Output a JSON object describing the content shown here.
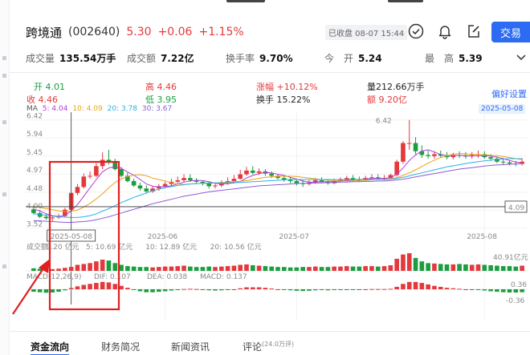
{
  "quote": {
    "name": "跨境通",
    "code": "(002640)",
    "price": "5.30",
    "change": "+0.06",
    "change_pct": "+1.15%",
    "status": "已收盘 08-07 15:44",
    "trade_label": "交易"
  },
  "stats": [
    {
      "label": "成交量",
      "value": "135.54万手"
    },
    {
      "label": "成交额",
      "value": "7.22亿"
    },
    {
      "label": "换手率",
      "value": "9.70%"
    },
    {
      "label": "今　开",
      "value": "5.24"
    },
    {
      "label": "最　高",
      "value": "5.39"
    }
  ],
  "candle_info": {
    "open": "开 4.01",
    "close": "收 4.46",
    "high": "高 4.46",
    "low": "低 3.95",
    "limit": "涨幅 +10.12%",
    "turnover": "换手 15.22%",
    "volume": "量212.66万手",
    "amount": "额 9.20亿"
  },
  "preference_label": "偏好设置",
  "ma_labels": {
    "ma": "MA",
    "ma5": "5: 4.04",
    "ma10": "10: 4.09",
    "ma20": "20: 3.78",
    "ma30": "30: 3.67"
  },
  "selected_date": "2025-05-08",
  "price_axis": [
    "6.42",
    "5.94",
    "5.45",
    "4.97",
    "4.48",
    "4.00",
    "3.52"
  ],
  "peak_label": "6.42",
  "crosshair_price": "4.09",
  "date_axis": [
    "2025-06",
    "2025-07",
    "2025-08"
  ],
  "volume_legend": {
    "title": "成交额",
    "v": "9.20 亿元",
    "v5": "5: 10.69 亿元",
    "v10": "10: 12.89 亿元",
    "v20": "20: 10.56 亿元",
    "axis_max": "40.91亿元"
  },
  "macd_legend": {
    "title": "MACD(12,26,9)",
    "dif": "DIF: 0.107",
    "dea": "DEA: 0.038",
    "macd": "MACD: 0.137",
    "axis_top": "0.36",
    "axis_bottom": "-0.36"
  },
  "tabs": [
    {
      "label": "资金流向",
      "active": true
    },
    {
      "label": "财务简况"
    },
    {
      "label": "新闻资讯"
    },
    {
      "label": "评论",
      "badge": "(24.0万评)"
    }
  ],
  "chart_data": {
    "type": "candlestick",
    "price_range": [
      3.4,
      6.5
    ],
    "open": [
      4.02,
      3.92,
      3.82,
      3.78,
      3.8,
      3.84,
      4.01,
      4.46,
      4.62,
      4.9,
      4.92,
      5.18,
      5.35,
      5.3,
      5.1,
      4.92,
      4.78,
      4.66,
      4.58,
      4.5,
      4.58,
      4.64,
      4.7,
      4.76,
      4.8,
      4.86,
      4.8,
      4.76,
      4.72,
      4.64,
      4.66,
      4.72,
      4.78,
      4.84,
      4.96,
      5.06,
      5.0,
      5.04,
      4.98,
      4.92,
      4.86,
      4.82,
      4.78,
      4.72,
      4.7,
      4.74,
      4.8,
      4.76,
      4.72,
      4.78,
      4.82,
      4.86,
      4.82,
      4.8,
      4.86,
      4.88,
      4.84,
      4.86,
      4.94,
      5.3,
      5.8,
      5.8,
      5.58,
      5.48,
      5.45,
      5.5,
      5.46,
      5.42,
      5.48,
      5.46,
      5.45,
      5.48,
      5.5,
      5.42,
      5.38,
      5.3,
      5.28,
      5.25,
      5.24
    ],
    "high": [
      4.12,
      4.0,
      3.9,
      3.84,
      3.9,
      4.06,
      4.46,
      4.7,
      4.98,
      5.04,
      5.26,
      5.55,
      5.62,
      5.38,
      5.16,
      5.0,
      4.84,
      4.74,
      4.66,
      4.64,
      4.7,
      4.76,
      4.84,
      4.9,
      4.96,
      4.96,
      4.86,
      4.8,
      4.76,
      4.74,
      4.8,
      4.88,
      4.94,
      5.08,
      5.16,
      5.18,
      5.12,
      5.1,
      5.04,
      4.96,
      4.92,
      4.88,
      4.84,
      4.8,
      4.8,
      4.86,
      4.88,
      4.82,
      4.84,
      4.88,
      4.92,
      4.94,
      4.9,
      4.92,
      4.96,
      4.96,
      4.94,
      4.98,
      5.35,
      5.85,
      6.42,
      5.96,
      5.74,
      5.6,
      5.58,
      5.6,
      5.56,
      5.54,
      5.58,
      5.56,
      5.56,
      5.6,
      5.58,
      5.5,
      5.44,
      5.4,
      5.34,
      5.32,
      5.39
    ],
    "low": [
      3.88,
      3.78,
      3.74,
      3.7,
      3.76,
      3.82,
      3.95,
      4.4,
      4.58,
      4.84,
      4.88,
      5.1,
      5.22,
      5.06,
      4.88,
      4.74,
      4.62,
      4.52,
      4.44,
      4.46,
      4.52,
      4.6,
      4.66,
      4.72,
      4.74,
      4.76,
      4.7,
      4.66,
      4.58,
      4.58,
      4.62,
      4.68,
      4.74,
      4.82,
      4.92,
      4.96,
      4.94,
      4.92,
      4.86,
      4.82,
      4.76,
      4.72,
      4.66,
      4.62,
      4.66,
      4.7,
      4.72,
      4.68,
      4.7,
      4.74,
      4.78,
      4.78,
      4.76,
      4.78,
      4.82,
      4.82,
      4.8,
      4.82,
      4.9,
      5.24,
      5.62,
      5.5,
      5.4,
      5.38,
      5.38,
      5.4,
      5.36,
      5.36,
      5.4,
      5.38,
      5.38,
      5.4,
      5.38,
      5.32,
      5.26,
      5.22,
      5.2,
      5.18,
      5.2
    ],
    "close": [
      3.92,
      3.82,
      3.78,
      3.8,
      3.84,
      4.01,
      4.46,
      4.62,
      4.9,
      4.92,
      5.18,
      5.35,
      5.3,
      5.1,
      4.92,
      4.78,
      4.66,
      4.58,
      4.5,
      4.58,
      4.64,
      4.7,
      4.76,
      4.8,
      4.86,
      4.8,
      4.76,
      4.72,
      4.64,
      4.66,
      4.72,
      4.78,
      4.84,
      4.96,
      5.06,
      5.0,
      5.04,
      4.98,
      4.92,
      4.86,
      4.82,
      4.78,
      4.72,
      4.7,
      4.74,
      4.8,
      4.76,
      4.72,
      4.78,
      4.82,
      4.86,
      4.82,
      4.8,
      4.86,
      4.88,
      4.84,
      4.86,
      4.94,
      5.3,
      5.8,
      5.8,
      5.58,
      5.48,
      5.45,
      5.5,
      5.46,
      5.42,
      5.48,
      5.46,
      5.45,
      5.48,
      5.5,
      5.42,
      5.38,
      5.3,
      5.28,
      5.25,
      5.24,
      5.3
    ],
    "volume": [
      6,
      5,
      5,
      4,
      5,
      7,
      9.2,
      14,
      16,
      18,
      22,
      26,
      24,
      18,
      14,
      11,
      10,
      9,
      9,
      8,
      9,
      10,
      10,
      11,
      12,
      10,
      9,
      9,
      10,
      9,
      10,
      11,
      12,
      14,
      15,
      13,
      12,
      11,
      10,
      9,
      9,
      8,
      8,
      9,
      9,
      10,
      9,
      9,
      10,
      10,
      11,
      10,
      10,
      11,
      11,
      10,
      11,
      13,
      28,
      38,
      40.91,
      30,
      22,
      18,
      17,
      16,
      15,
      15,
      16,
      15,
      14,
      15,
      14,
      13,
      12,
      11,
      11,
      10,
      12
    ],
    "ma5": [
      4.02,
      3.98,
      3.9,
      3.85,
      3.83,
      3.85,
      3.98,
      4.15,
      4.37,
      4.6,
      4.82,
      5.03,
      5.13,
      5.17,
      5.12,
      5.02,
      4.94,
      4.82,
      4.7,
      4.64,
      4.62,
      4.63,
      4.65,
      4.7,
      4.75,
      4.78,
      4.8,
      4.79,
      4.76,
      4.72,
      4.7,
      4.71,
      4.73,
      4.77,
      4.86,
      4.93,
      4.98,
      5.01,
      5.0,
      4.96,
      4.93,
      4.88,
      4.83,
      4.78,
      4.75,
      4.75,
      4.76,
      4.76,
      4.76,
      4.78,
      4.8,
      4.81,
      4.82,
      4.83,
      4.85,
      4.85,
      4.85,
      4.87,
      4.96,
      5.13,
      5.33,
      5.48,
      5.59,
      5.62,
      5.56,
      5.49,
      5.46,
      5.46,
      5.47,
      5.46,
      5.45,
      5.46,
      5.46,
      5.45,
      5.42,
      5.38,
      5.33,
      5.29,
      5.27
    ],
    "ma10": [
      4.1,
      4.07,
      4.04,
      4.01,
      3.98,
      3.96,
      3.97,
      4.0,
      4.08,
      4.18,
      4.3,
      4.44,
      4.6,
      4.74,
      4.84,
      4.9,
      4.94,
      4.95,
      4.92,
      4.86,
      4.82,
      4.78,
      4.74,
      4.7,
      4.69,
      4.7,
      4.71,
      4.72,
      4.72,
      4.73,
      4.74,
      4.75,
      4.76,
      4.77,
      4.79,
      4.82,
      4.85,
      4.88,
      4.89,
      4.9,
      4.91,
      4.91,
      4.9,
      4.88,
      4.86,
      4.84,
      4.82,
      4.8,
      4.79,
      4.78,
      4.78,
      4.78,
      4.79,
      4.8,
      4.81,
      4.82,
      4.83,
      4.84,
      4.87,
      4.93,
      5.0,
      5.08,
      5.17,
      5.26,
      5.34,
      5.41,
      5.46,
      5.5,
      5.52,
      5.51,
      5.5,
      5.49,
      5.48,
      5.47,
      5.46,
      5.44,
      5.41,
      5.38,
      5.36
    ],
    "ma20": [
      3.9,
      3.88,
      3.86,
      3.84,
      3.82,
      3.81,
      3.8,
      3.8,
      3.82,
      3.85,
      3.9,
      3.97,
      4.04,
      4.12,
      4.2,
      4.27,
      4.34,
      4.4,
      4.46,
      4.52,
      4.56,
      4.6,
      4.63,
      4.66,
      4.68,
      4.7,
      4.71,
      4.72,
      4.73,
      4.73,
      4.73,
      4.73,
      4.74,
      4.74,
      4.75,
      4.76,
      4.77,
      4.78,
      4.79,
      4.8,
      4.81,
      4.82,
      4.82,
      4.82,
      4.82,
      4.82,
      4.82,
      4.82,
      4.82,
      4.82,
      4.82,
      4.82,
      4.82,
      4.82,
      4.82,
      4.82,
      4.82,
      4.83,
      4.85,
      4.88,
      4.92,
      4.96,
      5.0,
      5.04,
      5.08,
      5.12,
      5.16,
      5.19,
      5.22,
      5.25,
      5.28,
      5.3,
      5.32,
      5.34,
      5.36,
      5.37,
      5.38,
      5.38,
      5.38
    ],
    "ma30": [
      3.72,
      3.71,
      3.7,
      3.69,
      3.68,
      3.67,
      3.67,
      3.68,
      3.69,
      3.71,
      3.74,
      3.78,
      3.82,
      3.87,
      3.92,
      3.97,
      4.02,
      4.07,
      4.12,
      4.17,
      4.21,
      4.25,
      4.29,
      4.33,
      4.37,
      4.4,
      4.43,
      4.46,
      4.49,
      4.51,
      4.53,
      4.55,
      4.57,
      4.59,
      4.61,
      4.63,
      4.65,
      4.66,
      4.67,
      4.68,
      4.69,
      4.7,
      4.71,
      4.72,
      4.72,
      4.73,
      4.73,
      4.74,
      4.74,
      4.75,
      4.75,
      4.76,
      4.76,
      4.77,
      4.77,
      4.78,
      4.78,
      4.79,
      4.81,
      4.83,
      4.86,
      4.89,
      4.92,
      4.95,
      4.98,
      5.01,
      5.04,
      5.07,
      5.1,
      5.12,
      5.14,
      5.16,
      5.18,
      5.2,
      5.21,
      5.22,
      5.23,
      5.24,
      5.25
    ],
    "macd_hist": [
      -0.1,
      -0.12,
      -0.14,
      -0.13,
      -0.1,
      -0.04,
      0.05,
      0.12,
      0.18,
      0.22,
      0.26,
      0.3,
      0.28,
      0.22,
      0.14,
      0.06,
      -0.02,
      -0.08,
      -0.12,
      -0.12,
      -0.1,
      -0.08,
      -0.05,
      -0.02,
      0.01,
      0.02,
      0.01,
      -0.01,
      -0.04,
      -0.05,
      -0.04,
      -0.02,
      0.0,
      0.04,
      0.08,
      0.08,
      0.08,
      0.06,
      0.03,
      0.0,
      -0.02,
      -0.04,
      -0.06,
      -0.07,
      -0.06,
      -0.04,
      -0.03,
      -0.04,
      -0.03,
      -0.02,
      -0.01,
      -0.01,
      -0.01,
      0.0,
      0.01,
      0.01,
      0.01,
      0.02,
      0.1,
      0.22,
      0.3,
      0.3,
      0.26,
      0.2,
      0.14,
      0.1,
      0.06,
      0.04,
      0.02,
      0.0,
      -0.02,
      -0.03,
      -0.05,
      -0.08,
      -0.1,
      -0.12,
      -0.13,
      -0.13,
      -0.12
    ],
    "macd_range": [
      -0.36,
      0.36
    ]
  }
}
